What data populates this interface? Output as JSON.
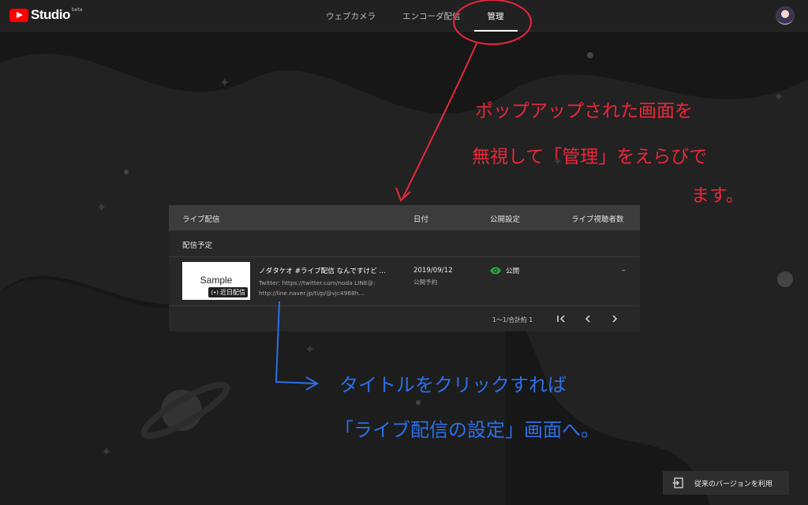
{
  "app": {
    "logo_text": "Studio",
    "logo_badge": "beta"
  },
  "tabs": [
    {
      "label": "ウェブカメラ",
      "active": false
    },
    {
      "label": "エンコーダ配信",
      "active": false
    },
    {
      "label": "管理",
      "active": true
    }
  ],
  "table": {
    "headers": {
      "title": "ライブ配信",
      "date": "日付",
      "visibility": "公開設定",
      "viewers": "ライブ視聴者数"
    },
    "section_label": "配信予定",
    "rows": [
      {
        "thumbnail_text": "Sample",
        "thumbnail_badge": "近日配信",
        "title": "ノダタケオ #ライブ配信 なんですけど ...",
        "description_line1": "Twitter: https://twitter.com/noda LINE@:",
        "description_line2": "http://line.naver.jp/ti/p/@vjc4968h...",
        "date": "2019/09/12",
        "schedule_status": "公開予約",
        "visibility": "公開",
        "viewers": "–"
      }
    ],
    "pagination": {
      "range": "1〜1/合計約 1"
    }
  },
  "legacy_button": {
    "label": "従来のバージョンを利用"
  },
  "annotations": {
    "red_line1": "ポップアップされた画面を",
    "red_line2": "無視して「管理」をえらびで",
    "red_line3": "ます。",
    "blue_line1": "タイトルをクリックすれば",
    "blue_line2": "「ライブ配信の設定」画面へ。"
  },
  "colors": {
    "accent_red": "#ff0000",
    "annotation_red": "#e8283a",
    "annotation_blue": "#2b6fe8",
    "public_green": "#2ba640"
  }
}
